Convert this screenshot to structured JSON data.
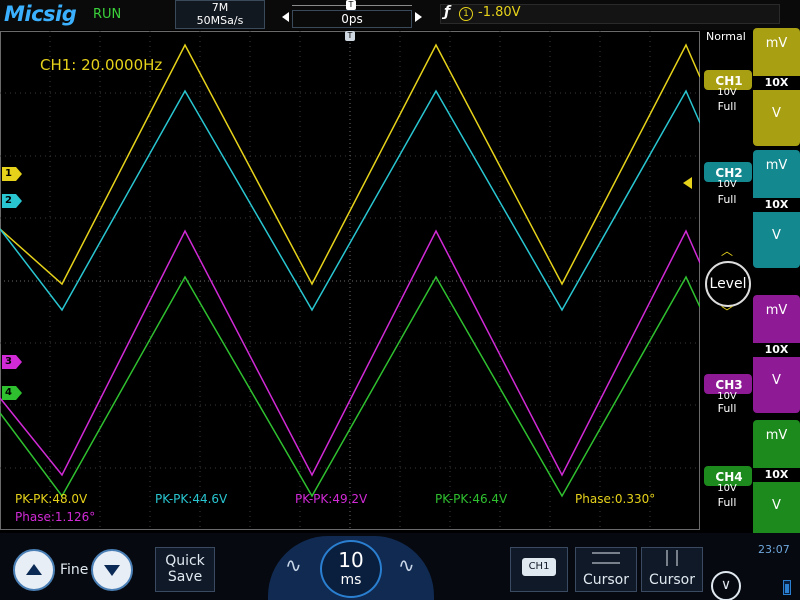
{
  "header": {
    "brand": "Micsig",
    "run_state": "RUN",
    "memory_depth": "7M",
    "sample_rate": "50MSa/s",
    "timebase_offset": "0ps",
    "trigger_source": "1",
    "trigger_level": "-1.80V"
  },
  "display": {
    "freq_readout": "CH1: 20.0000Hz",
    "measurements": [
      {
        "label": "PK-PK:48.0V",
        "color": "#e6d21a"
      },
      {
        "label": "PK-PK:44.6V",
        "color": "#29c6d1"
      },
      {
        "label": "PK-PK:49.2V",
        "color": "#d12ad6"
      },
      {
        "label": "PK-PK:46.4V",
        "color": "#2fc02f"
      },
      {
        "label": "Phase:0.330°",
        "color": "#e6d21a"
      },
      {
        "label": "Phase:1.126°",
        "color": "#d12ad6"
      }
    ],
    "channel_markers": [
      "1",
      "2",
      "3",
      "4"
    ]
  },
  "side_panel": {
    "acq_mode": "Normal",
    "level_label": "Level",
    "channels": [
      {
        "name": "CH1",
        "scale": "10V",
        "bw": "Full",
        "color": "#a8a012"
      },
      {
        "name": "CH2",
        "scale": "10V",
        "bw": "Full",
        "color": "#14888f"
      },
      {
        "name": "CH3",
        "scale": "10V",
        "bw": "Full",
        "color": "#8e1a95"
      },
      {
        "name": "CH4",
        "scale": "10V",
        "bw": "Full",
        "color": "#1d8a1d"
      }
    ],
    "units": [
      {
        "top": "mV",
        "probe": "10X",
        "bottom": "V",
        "color": "#a8a012"
      },
      {
        "top": "mV",
        "probe": "10X",
        "bottom": "V",
        "color": "#14888f"
      },
      {
        "top": "mV",
        "probe": "10X",
        "bottom": "V",
        "color": "#8e1a95"
      },
      {
        "top": "mV",
        "probe": "10X",
        "bottom": "V",
        "color": "#1d8a1d"
      }
    ]
  },
  "bottom_bar": {
    "fine_label": "Fine",
    "quick_save_line1": "Quick",
    "quick_save_line2": "Save",
    "timebase_value": "10",
    "timebase_unit": "ms",
    "ch_select": "CH1",
    "cursor1": "Cursor",
    "cursor2": "Cursor",
    "time": "23:07"
  },
  "icons": [
    "up-arrow-icon",
    "down-arrow-icon",
    "wave-left-icon",
    "wave-right-icon",
    "horizontal-cursor-icon",
    "vertical-cursor-icon",
    "menu-chevron-icon",
    "battery-icon"
  ]
}
